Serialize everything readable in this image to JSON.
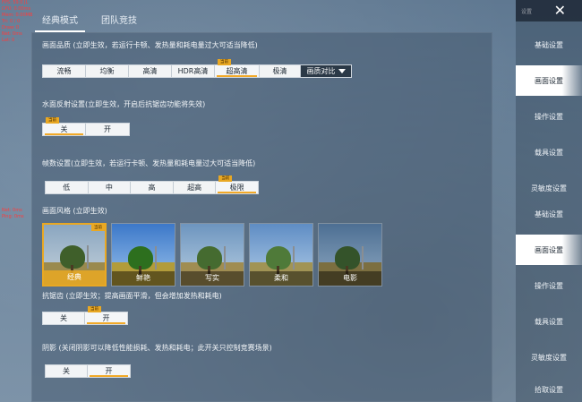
{
  "debug_top": [
    "FPS: 59.0 JL",
    "CPU: 0.00ms",
    "Mem: 0.00MB",
    "Tri: 0 / 0",
    "Draw: 0",
    "Net: 0ms",
    "Lat: 0"
  ],
  "debug_mid": [
    "Net: 0ms",
    "Ping: 0ms"
  ],
  "mode_tabs": [
    {
      "label": "经典模式"
    },
    {
      "label": "团队竞技"
    }
  ],
  "graphics": {
    "title": "画面品质 (立即生效，若运行卡顿、发热量和耗电量过大可适当降低)",
    "options": [
      "流畅",
      "均衡",
      "高清",
      "HDR高清",
      "超高清",
      "极清",
      "画质对比"
    ],
    "selected": "超高清",
    "badge": "当前"
  },
  "water": {
    "title": "水面反射设置(立即生效，开启后抗锯齿功能将失效)",
    "options": [
      "关",
      "开"
    ],
    "selected": "关",
    "badge": "当前"
  },
  "fps": {
    "title": "帧数设置(立即生效，若运行卡顿、发热量和耗电量过大可适当降低)",
    "options": [
      "低",
      "中",
      "高",
      "超高",
      "极限"
    ],
    "selected": "极限",
    "badge": "当前"
  },
  "style": {
    "title": "画面风格 (立即生效)",
    "badge": "当前",
    "cards": [
      {
        "label": "经典"
      },
      {
        "label": "鲜艳"
      },
      {
        "label": "写实"
      },
      {
        "label": "柔和"
      },
      {
        "label": "电影"
      }
    ],
    "selected": "经典"
  },
  "aa": {
    "title": "抗锯齿 (立即生效；提高画面平滑，但会增加发热和耗电)",
    "options": [
      "关",
      "开"
    ],
    "selected": "开",
    "badge": "当前"
  },
  "shadow": {
    "title": "阴影 (关闭阴影可以降低性能损耗、发热和耗电；此开关只控制竞赛场景)",
    "options": [
      "关",
      "开"
    ],
    "selected": "开"
  },
  "sidebar": {
    "close_faint": "设置",
    "items_top": [
      {
        "label": "基础设置"
      },
      {
        "label": "画面设置"
      },
      {
        "label": "操作设置"
      },
      {
        "label": "载具设置"
      },
      {
        "label": "灵敏度设置"
      }
    ],
    "items_bottom": [
      {
        "label": "基础设置"
      },
      {
        "label": "画面设置"
      },
      {
        "label": "操作设置"
      },
      {
        "label": "载具设置"
      },
      {
        "label": "灵敏度设置"
      },
      {
        "label": "拾取设置"
      }
    ],
    "active": "画面设置"
  }
}
